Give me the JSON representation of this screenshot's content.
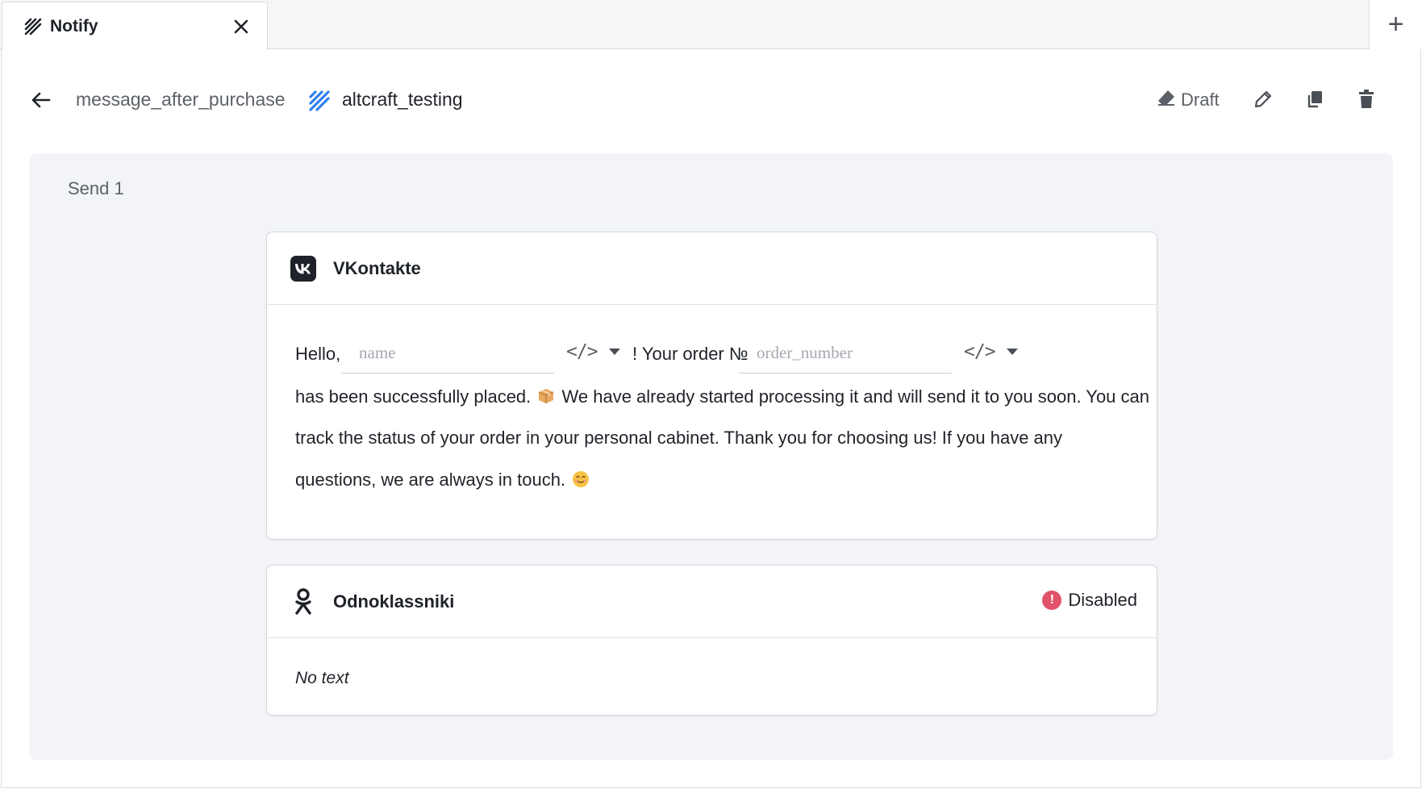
{
  "tabs": [
    {
      "label": "Notify",
      "icon": "notify-logo-icon"
    }
  ],
  "new_tab_label": "+",
  "header": {
    "message_name": "message_after_purchase",
    "database_name": "altcraft_testing",
    "status_label": "Draft"
  },
  "panel": {
    "title": "Send 1"
  },
  "vk_card": {
    "title": "VKontakte",
    "greeting": "Hello,",
    "name_placeholder": "name",
    "order_text": "! Your order №",
    "order_placeholder": "order_number",
    "code_label": "</>",
    "line1_before": "has been successfully placed. ",
    "line1_after": " We have already started processing it and will send it to you soon. You can",
    "line2": "track the status of your order in your personal cabinet. Thank you for choosing us! If you have any",
    "line3": "questions, we are always in touch. "
  },
  "ok_card": {
    "title": "Odnoklassniki",
    "status_label": "Disabled",
    "status_icon": "!",
    "body_text": "No text"
  },
  "colors": {
    "panel_bg": "#f2f4f7",
    "brand_blue": "#2f80ed",
    "danger": "#e0536b"
  }
}
